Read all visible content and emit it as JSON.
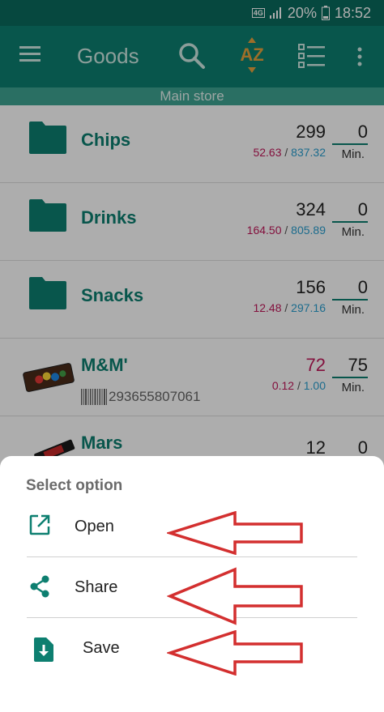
{
  "status_bar": {
    "network": "4G",
    "battery": "20%",
    "time": "18:52"
  },
  "app_bar": {
    "menu_icon": "hamburger-menu-icon",
    "title": "Goods",
    "search_icon": "search-icon",
    "sort_icon": "sort-az-icon",
    "sort_label": "AZ",
    "list_view_icon": "list-view-icon",
    "more_icon": "more-vert-icon",
    "store": "Main store"
  },
  "items": [
    {
      "type": "folder",
      "name": "Chips",
      "qty": "299",
      "buy": "52.63",
      "sell": "837.32",
      "min": "0",
      "min_label": "Min."
    },
    {
      "type": "folder",
      "name": "Drinks",
      "qty": "324",
      "buy": "164.50",
      "sell": "805.89",
      "min": "0",
      "min_label": "Min."
    },
    {
      "type": "folder",
      "name": "Snacks",
      "qty": "156",
      "buy": "12.48",
      "sell": "297.16",
      "min": "0",
      "min_label": "Min."
    },
    {
      "type": "product",
      "name": "M&M'",
      "barcode": "293655807061",
      "qty": "72",
      "buy": "0.12",
      "sell": "1.00",
      "min": "75",
      "min_label": "Min."
    },
    {
      "type": "product",
      "name": "Mars",
      "qty": "12",
      "min": "0"
    }
  ],
  "price_separator": " / ",
  "sheet": {
    "title": "Select option",
    "options": [
      {
        "label": "Open",
        "icon": "open-in-new-icon"
      },
      {
        "label": "Share",
        "icon": "share-icon"
      },
      {
        "label": "Save",
        "icon": "save-file-icon"
      }
    ]
  },
  "colors": {
    "primary": "#0d7f70",
    "accent_sort": "#e8a33d",
    "buy_price": "#c2185b",
    "sell_price": "#2a9fd0",
    "arrow": "#d32f2f"
  }
}
